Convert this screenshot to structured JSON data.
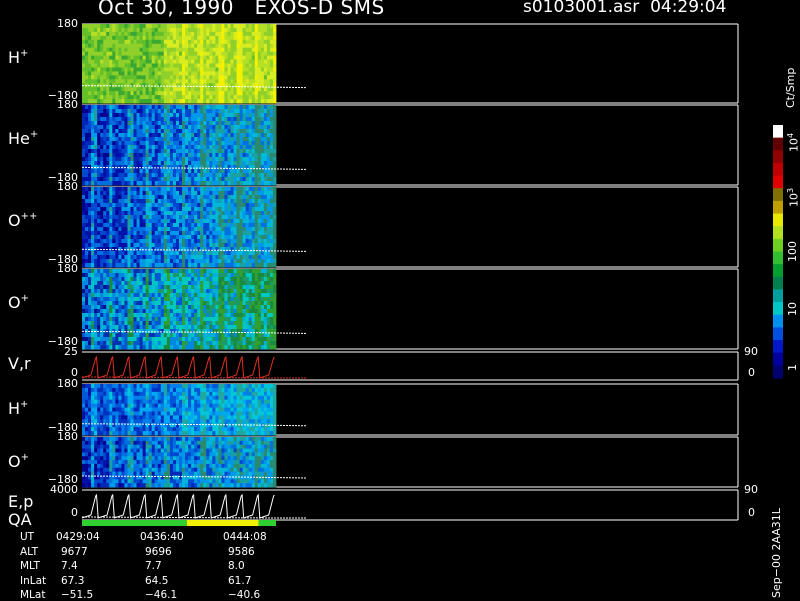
{
  "header": {
    "date": "Oct 30, 1990",
    "instrument": "EXOS-D SMS",
    "filename": "s0103001.asr",
    "time": "04:29:04"
  },
  "chart_data": {
    "type": "heatmap",
    "panels": [
      {
        "id": "h_plus",
        "label": "H",
        "sup": "+",
        "ytop": "180",
        "ybot": "−180",
        "ylim": [
          -180,
          180
        ]
      },
      {
        "id": "he_plus",
        "label": "He",
        "sup": "+",
        "ytop": "180",
        "ybot": "−180",
        "ylim": [
          -180,
          180
        ]
      },
      {
        "id": "o_plusplus",
        "label": "O",
        "sup": "++",
        "ytop": "180",
        "ybot": "−180",
        "ylim": [
          -180,
          180
        ]
      },
      {
        "id": "o_plus",
        "label": "O",
        "sup": "+",
        "ytop": "180",
        "ybot": "−180",
        "ylim": [
          -180,
          180
        ]
      },
      {
        "id": "vr",
        "label": "V,r",
        "sup": "",
        "ytop": "25",
        "ybot": "0",
        "rtop": "90",
        "rbot": "0",
        "ylim": [
          0,
          25
        ]
      },
      {
        "id": "h_plus_2",
        "label": "H",
        "sup": "+",
        "ytop": "180",
        "ybot": "−180",
        "ylim": [
          -180,
          180
        ]
      },
      {
        "id": "o_plus_2",
        "label": "O",
        "sup": "+",
        "ytop": "180",
        "ybot": "−180",
        "ylim": [
          -180,
          180
        ]
      },
      {
        "id": "ep",
        "label": "E,p",
        "sup": "",
        "ytop": "4000",
        "ybot": "0",
        "rtop": "90",
        "rbot": "0",
        "ylim": [
          0,
          4000
        ]
      }
    ],
    "qa": {
      "label": "QA",
      "segments": [
        {
          "value": "green",
          "fraction": 0.54
        },
        {
          "value": "yellow",
          "fraction": 0.37
        },
        {
          "value": "green",
          "fraction": 0.09
        }
      ]
    },
    "colorbar": {
      "unit": "Ct/Smp",
      "scale": "log",
      "range": [
        0.5,
        20000
      ],
      "tick_labels": [
        {
          "base": "1",
          "exp": "",
          "value": 1
        },
        {
          "base": "10",
          "exp": "",
          "value": 10
        },
        {
          "base": "100",
          "exp": "",
          "value": 100
        },
        {
          "base": "10",
          "exp": "3",
          "value": 1000
        },
        {
          "base": "10",
          "exp": "4",
          "value": 10000
        }
      ],
      "colors": [
        "#00006e",
        "#00009c",
        "#0018c8",
        "#0050e0",
        "#0090f0",
        "#00c8c8",
        "#00a0a0",
        "#008050",
        "#00a030",
        "#30c030",
        "#70d020",
        "#b0e020",
        "#e8e800",
        "#c0a000",
        "#807000",
        "#e00000",
        "#c00000",
        "#900000",
        "#600000",
        "#ffffff"
      ]
    },
    "ephemeris": {
      "rows": [
        {
          "name": "UT",
          "values": [
            "0429:04",
            "0436:40",
            "0444:08"
          ]
        },
        {
          "name": "ALT",
          "values": [
            "9677",
            "9696",
            "9586"
          ]
        },
        {
          "name": "MLT",
          "values": [
            "7.4",
            "7.7",
            "8.0"
          ]
        },
        {
          "name": "InLat",
          "values": [
            "67.3",
            "64.5",
            "61.7"
          ]
        },
        {
          "name": "MLat",
          "values": [
            "−51.5",
            "−46.1",
            "−40.6"
          ]
        }
      ]
    },
    "version": "Sep−00  2AA31L",
    "colors": {
      "white": "#ffffff",
      "red": "#e03020",
      "qa_green": "#30d030",
      "qa_yellow": "#f0f000"
    }
  }
}
